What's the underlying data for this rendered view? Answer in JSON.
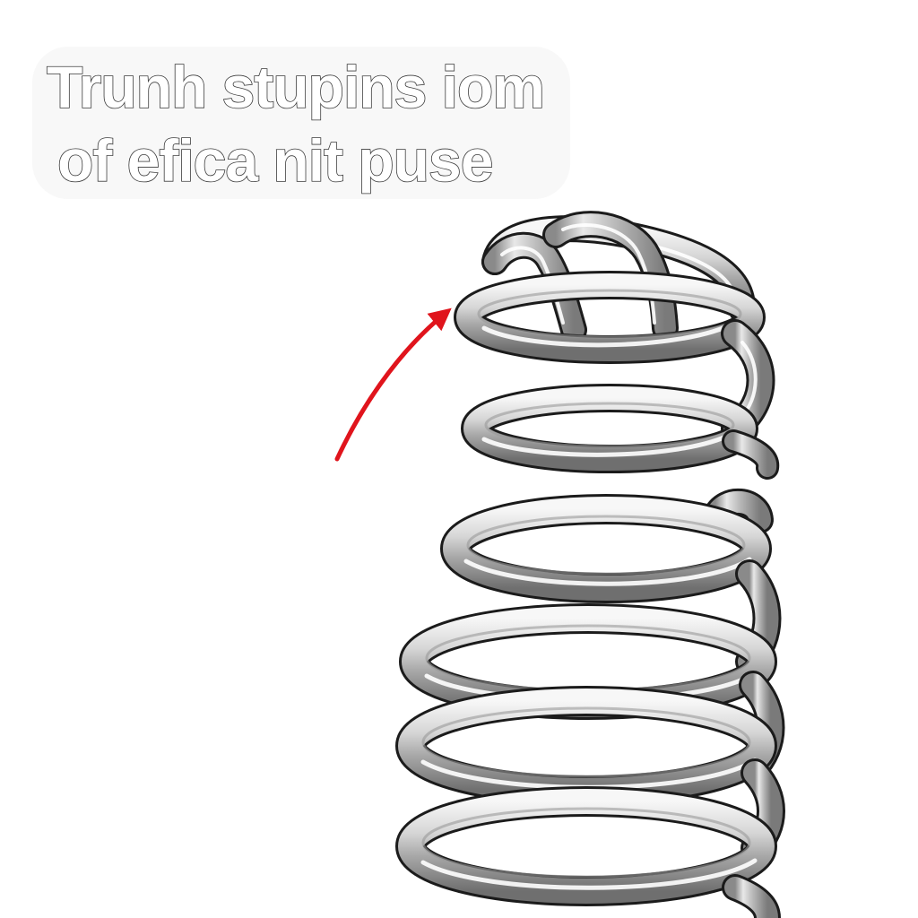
{
  "caption": {
    "lines": [
      "Trunh stupins iom",
      "of efica nit puse"
    ]
  },
  "spring": {
    "icon": "coil-spring-icon",
    "segments": [
      "upper-coil-section",
      "lower-coil-section"
    ]
  },
  "arrow": {
    "icon": "curved-arrow-icon",
    "color": "#e0141c"
  },
  "colors": {
    "background": "#ffffff",
    "outline": "#1b1b1b",
    "steel_light": "#f4f4f4",
    "steel_mid": "#c8c8c8",
    "steel_dark": "#7c7c7c"
  }
}
